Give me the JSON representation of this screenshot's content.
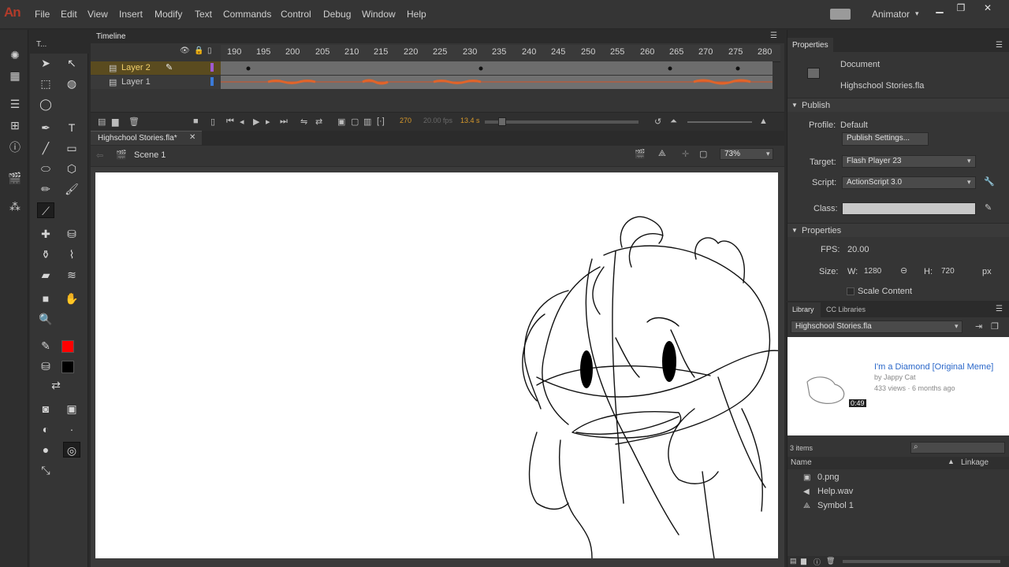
{
  "app": {
    "logo": "An",
    "workspace": "Animator"
  },
  "menu": [
    "File",
    "Edit",
    "View",
    "Insert",
    "Modify",
    "Text",
    "Commands",
    "Control",
    "Debug",
    "Window",
    "Help"
  ],
  "tools_panel": {
    "title": "T..."
  },
  "timeline": {
    "title": "Timeline",
    "ruler": [
      "190",
      "195",
      "200",
      "205",
      "210",
      "215",
      "220",
      "225",
      "230",
      "235",
      "240",
      "245",
      "250",
      "255",
      "260",
      "265",
      "270",
      "275",
      "280"
    ],
    "layers": [
      {
        "name": "Layer 2"
      },
      {
        "name": "Layer 1"
      }
    ],
    "current_frame": "270",
    "fps_display": "20.00 fps",
    "time": "13.4 s"
  },
  "document": {
    "tab": "Highschool Stories.fla*",
    "scene": "Scene 1",
    "zoom": "73%"
  },
  "properties": {
    "tab": "Properties",
    "doc_type": "Document",
    "doc_name": "Highschool Stories.fla",
    "publish": {
      "section": "Publish",
      "profile_label": "Profile:",
      "profile": "Default",
      "settings_button": "Publish Settings...",
      "target_label": "Target:",
      "target": "Flash Player 23",
      "script_label": "Script:",
      "script": "ActionScript 3.0",
      "class_label": "Class:"
    },
    "props": {
      "section": "Properties",
      "fps_label": "FPS:",
      "fps": "20.00",
      "size_label": "Size:",
      "w_label": "W:",
      "w": "1280",
      "h_label": "H:",
      "h": "720",
      "unit": "px",
      "scale_content": "Scale Content"
    }
  },
  "library": {
    "tabs": [
      "Library",
      "CC Libraries"
    ],
    "file": "Highschool Stories.fla",
    "preview": {
      "title": "I'm a Diamond [Original Meme]",
      "by": "by Jappy Cat",
      "meta": "433 views · 6 months ago",
      "duration": "0:49"
    },
    "count": "3 items",
    "col_name": "Name",
    "col_linkage": "Linkage",
    "items": [
      {
        "name": "0.png",
        "icon": "bitmap-icon"
      },
      {
        "name": "Help.wav",
        "icon": "sound-icon"
      },
      {
        "name": "Symbol 1",
        "icon": "graphic-symbol-icon"
      }
    ]
  }
}
